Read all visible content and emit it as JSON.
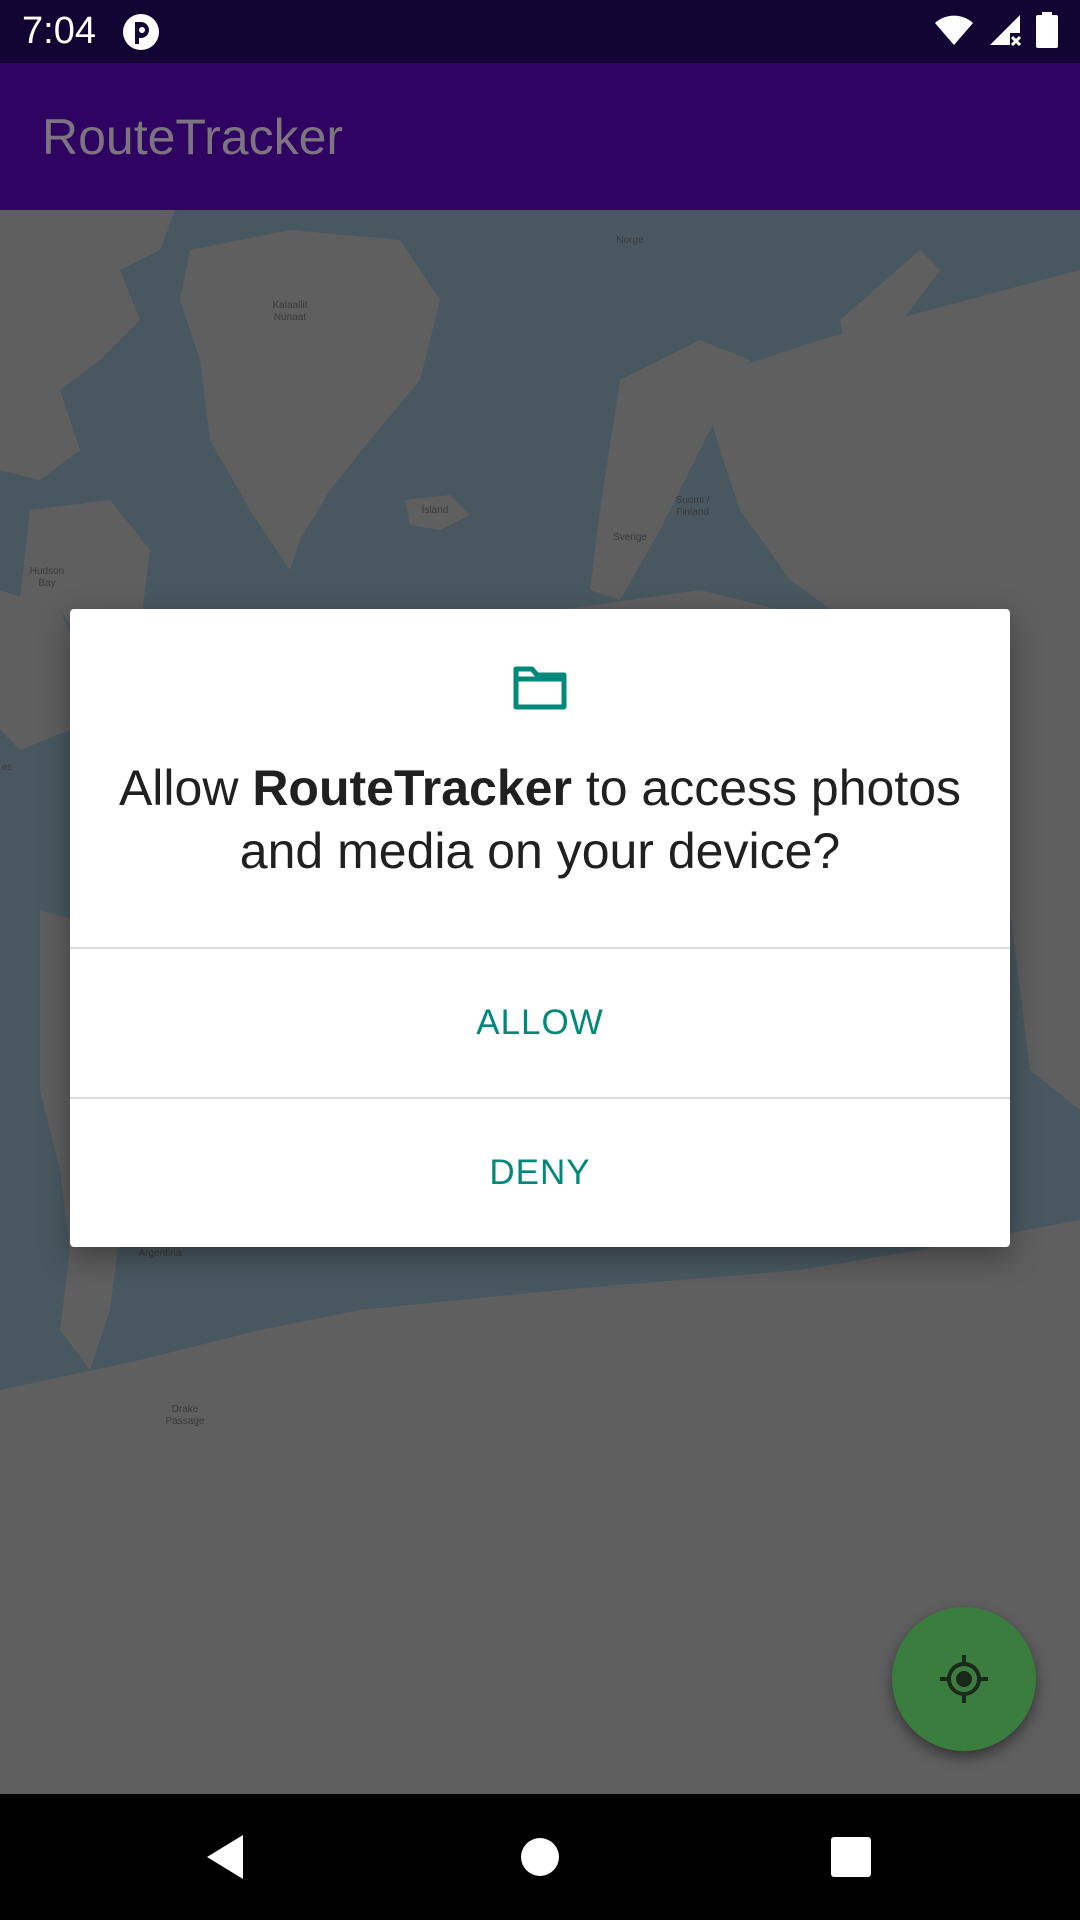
{
  "status_bar": {
    "time": "7:04",
    "icons": [
      "app-notification-icon",
      "wifi-icon",
      "signal-icon",
      "battery-icon"
    ]
  },
  "app_bar": {
    "title": "RouteTracker"
  },
  "map": {
    "labels": {
      "norge": "Norge",
      "kalaallit": "Kalaallit Nunaat",
      "island": "Ísland",
      "sverige": "Sverige",
      "suomi": "Suomi / Finland",
      "hudson": "Hudson Bay",
      "argentina": "Argentina",
      "drake": "Drake Passage",
      "edge": "es"
    }
  },
  "dialog": {
    "icon": "folder-icon",
    "message_prefix": "Allow ",
    "app_name": "RouteTracker",
    "message_suffix": " to access photos and media on your device?",
    "allow_label": "ALLOW",
    "deny_label": "DENY"
  },
  "fab": {
    "icon": "my-location-icon"
  },
  "nav_bar": {
    "icons": [
      "back-icon",
      "home-icon",
      "recents-icon"
    ]
  },
  "colors": {
    "status_bar": "#120533",
    "app_bar": "#2e0361",
    "accent": "#00897b",
    "fab": "#3b7d3f"
  }
}
